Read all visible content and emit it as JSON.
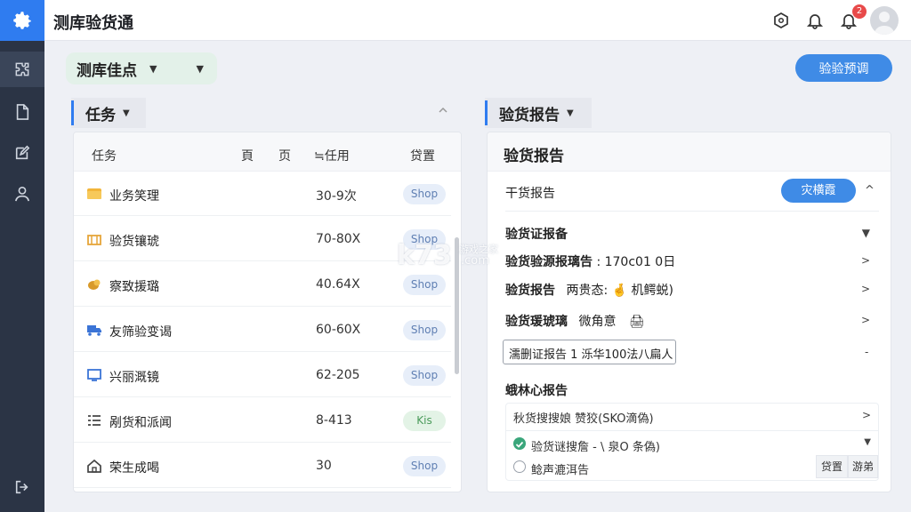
{
  "app": {
    "title": "测库验货通"
  },
  "topbar": {
    "notification_count": "2"
  },
  "filter": {
    "label": "测库佳点"
  },
  "actions": {
    "primary_label": "验验预调"
  },
  "tasks": {
    "section_title": "任务",
    "columns": [
      "任务",
      "頁",
      "页",
      "≒任用",
      "贷置"
    ],
    "rows": [
      {
        "name": "业务笑理",
        "value": "30-9次",
        "status": "Shop",
        "icon": "folder-icon",
        "color": "#f2b53a"
      },
      {
        "name": "验货镶琥",
        "value": "70-80X",
        "status": "Shop",
        "icon": "box-icon",
        "color": "#e6a53a"
      },
      {
        "name": "察致援璐",
        "value": "40.64X",
        "status": "Shop",
        "icon": "coins-icon",
        "color": "#d89a2a"
      },
      {
        "name": "友筛验变谒",
        "value": "60-60X",
        "status": "Shop",
        "icon": "truck-icon",
        "color": "#3b74d6"
      },
      {
        "name": "兴丽溉镜",
        "value": "62-205",
        "status": "Shop",
        "icon": "monitor-icon",
        "color": "#3b74d6"
      },
      {
        "name": "剐货和派闻",
        "value": "8-413",
        "status": "Kis",
        "icon": "list-icon",
        "color": "#444444"
      },
      {
        "name": "荣生成喝",
        "value": "30",
        "status": "Shop",
        "icon": "home-icon",
        "color": "#444444"
      }
    ]
  },
  "report": {
    "section_title": "验货报告",
    "panel_title": "验货报告",
    "summary_label": "干货报告",
    "summary_button": "灾横霞",
    "group_title": "验货证报备",
    "items": [
      {
        "label": "验货验源报璃告",
        "value": ": 170c01 0日"
      },
      {
        "label": "验货报告",
        "value": "两贵态: 🤞 机鳄蜕)"
      },
      {
        "label": "验货瑗琥璃",
        "value": "微角意"
      }
    ],
    "boxed_text": "濡删证报告 1 泺华100法八扁人",
    "center_title": "蛾林心报告",
    "checklist_header": "秋货搜搜娘 赞狡(SKO滴偽)",
    "check_done": "验货谜搜詹 - \\ 泉O 条偽)",
    "check_open": "鲶声漉洱告",
    "btn_a": "贷置",
    "btn_b": "游弟"
  },
  "watermark": {
    "text": "k73",
    "sub": "游戏之家",
    "domain": ".com"
  }
}
